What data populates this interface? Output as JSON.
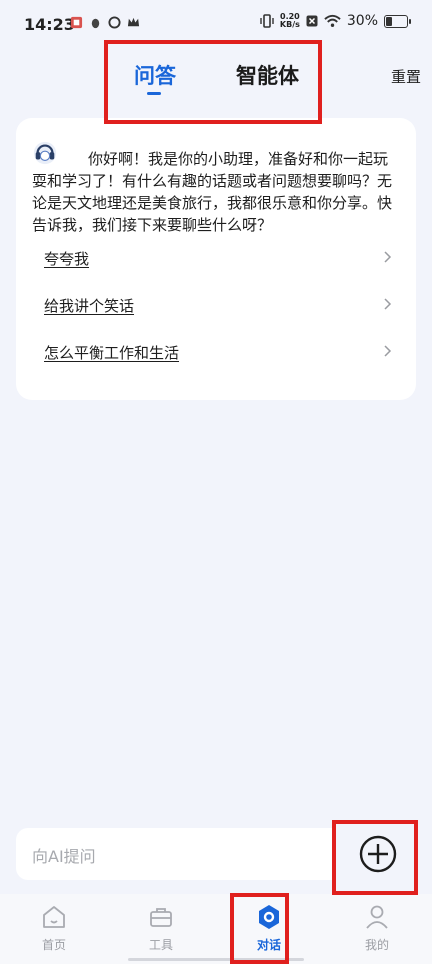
{
  "status_bar": {
    "time": "14:23",
    "net_speed_value": "0.20",
    "net_speed_unit": "KB/s",
    "battery": "30%",
    "battery_level": 0.3
  },
  "header": {
    "tabs": [
      {
        "label": "问答",
        "active": true
      },
      {
        "label": "智能体",
        "active": false
      }
    ],
    "reset_label": "重置"
  },
  "assistant_card": {
    "greeting": "你好啊！我是你的小助理，准备好和你一起玩耍和学习了！有什么有趣的话题或者问题想要聊吗？无论是天文地理还是美食旅行，我都很乐意和你分享。快告诉我，我们接下来要聊些什么呀？",
    "suggestions": [
      {
        "label": "夸夸我"
      },
      {
        "label": "给我讲个笑话"
      },
      {
        "label": "怎么平衡工作和生活"
      }
    ]
  },
  "input": {
    "placeholder": "向AI提问"
  },
  "bottom_nav": {
    "items": [
      {
        "label": "首页",
        "icon": "home-icon",
        "active": false
      },
      {
        "label": "工具",
        "icon": "toolbox-icon",
        "active": false
      },
      {
        "label": "对话",
        "icon": "chat-hexagon-icon",
        "active": true
      },
      {
        "label": "我的",
        "icon": "person-icon",
        "active": false
      }
    ]
  },
  "colors": {
    "accent": "#1a66d9",
    "background": "#f2f4fb",
    "annotation": "#e0201e"
  }
}
